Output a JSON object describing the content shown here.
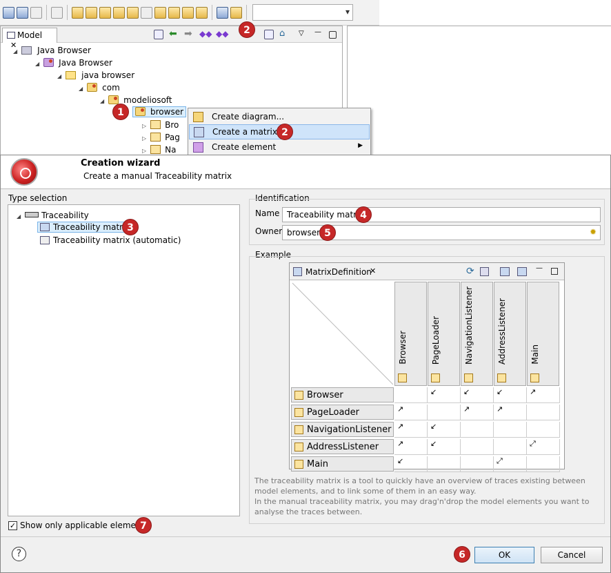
{
  "toolbar": {
    "combo_value": ""
  },
  "model_view": {
    "tab_label": "Model",
    "tree": [
      {
        "label": "Java Browser",
        "level": 0
      },
      {
        "label": "Java Browser",
        "level": 1
      },
      {
        "label": "java browser",
        "level": 2
      },
      {
        "label": "com",
        "level": 3
      },
      {
        "label": "modeliosoft",
        "level": 4
      },
      {
        "label": "browser",
        "level": 5,
        "selected": true
      },
      {
        "label": "Bro",
        "level": 6
      },
      {
        "label": "Pag",
        "level": 6
      },
      {
        "label": "Na",
        "level": 6
      }
    ]
  },
  "context_menu": {
    "items": [
      {
        "label": "Create diagram...",
        "icon": "diagram-icon"
      },
      {
        "label": "Create a matrix...",
        "icon": "matrix-icon",
        "highlighted": true
      },
      {
        "label": "Create element",
        "icon": "element-icon",
        "submenu": true
      }
    ]
  },
  "badges": {
    "b1": "1",
    "b2a": "2",
    "b2b": "2",
    "b3": "3",
    "b4": "4",
    "b5": "5",
    "b6": "6",
    "b7": "7"
  },
  "wizard": {
    "title": "Creation wizard",
    "subtitle": "Create a manual Traceability matrix",
    "type_selection": {
      "title": "Type selection",
      "root": "Traceability",
      "items": [
        "Traceability matrix",
        "Traceability matrix (automatic)"
      ]
    },
    "identification": {
      "title": "Identification",
      "name_label": "Name",
      "name_value": "Traceability matrix",
      "owner_label": "Owner",
      "owner_value": "browser"
    },
    "example": {
      "title": "Example",
      "tab_label": "MatrixDefinition",
      "columns": [
        "Browser",
        "PageLoader",
        "NavigationListener",
        "AddressListener",
        "Main"
      ],
      "rows": [
        {
          "label": "Browser",
          "cells": [
            "",
            "↙",
            "↙",
            "↙",
            "↗"
          ]
        },
        {
          "label": "PageLoader",
          "cells": [
            "↗",
            "",
            "↗",
            "↗",
            ""
          ]
        },
        {
          "label": "NavigationListener",
          "cells": [
            "↗",
            "↙",
            "",
            "",
            ""
          ]
        },
        {
          "label": "AddressListener",
          "cells": [
            "↗",
            "↙",
            "",
            "",
            "⤢"
          ]
        },
        {
          "label": "Main",
          "cells": [
            "↙",
            "",
            "",
            "⤢",
            ""
          ]
        }
      ],
      "description_1": "The traceability matrix is a tool to quickly have an overview of traces existing between model elements, and to link some of them in an easy way.",
      "description_2": "In the manual traceability matrix, you may drag'n'drop the model elements you want to analyse the traces between."
    },
    "show_applicable_label": "Show only applicable elements",
    "show_applicable_checked": true,
    "help_icon": "?",
    "ok_label": "OK",
    "cancel_label": "Cancel"
  },
  "colors": {
    "badge": "#c62828",
    "selection": "#dbeefc",
    "accent": "#3c7fb1"
  }
}
